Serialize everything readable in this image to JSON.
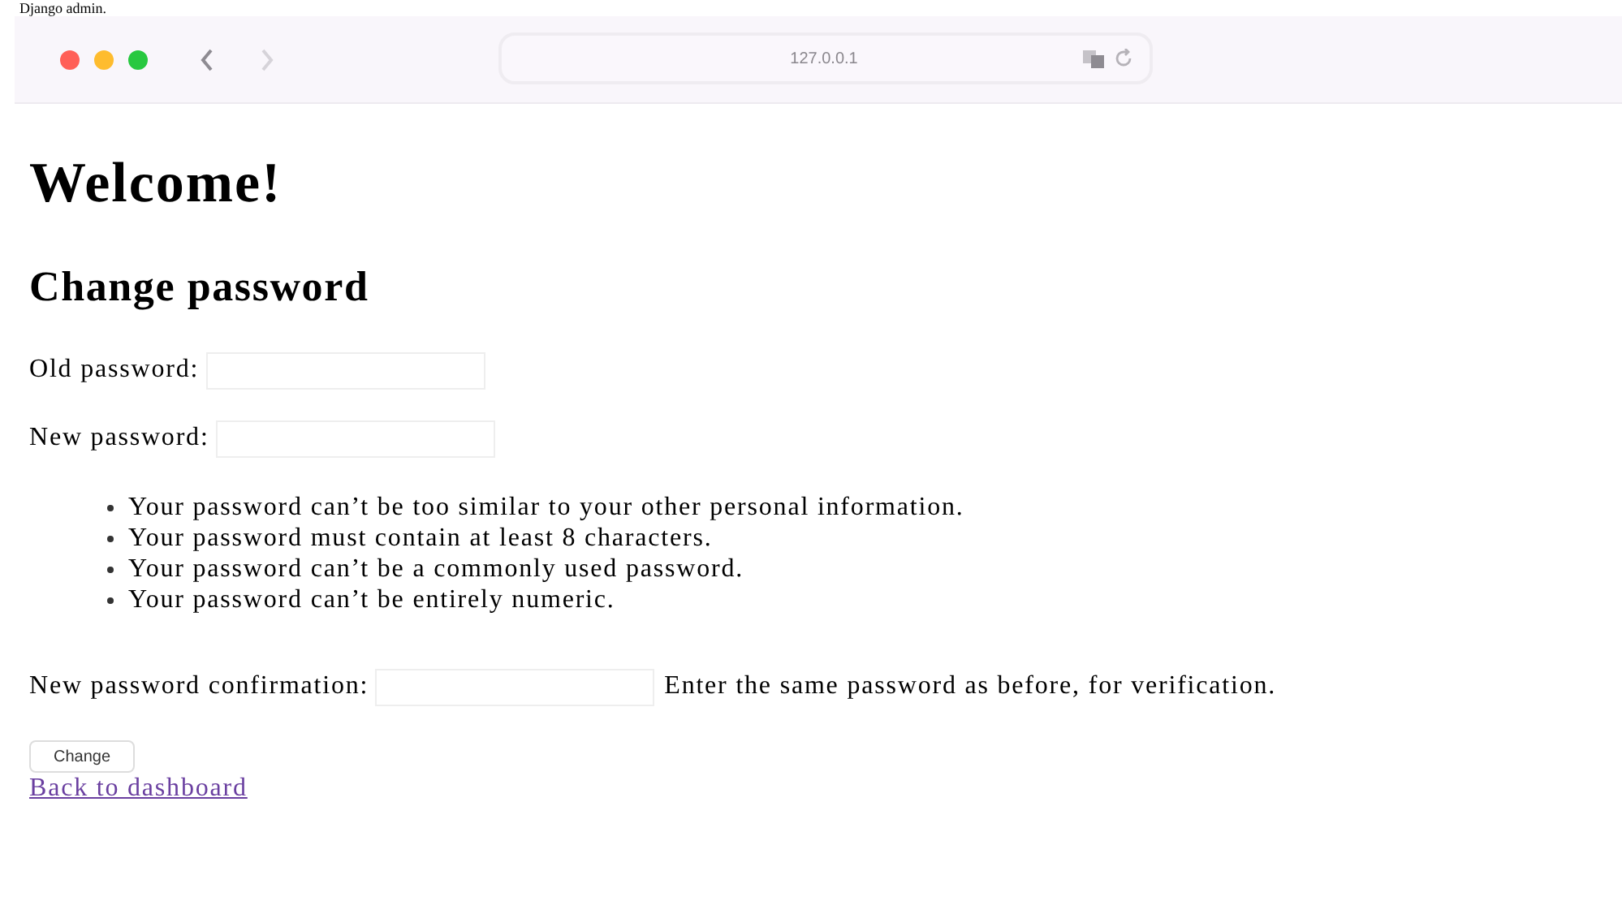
{
  "site_title": "Django admin.",
  "browser": {
    "url": "127.0.0.1",
    "nav": [
      {
        "kind": "back",
        "disabled": false
      },
      {
        "kind": "forward",
        "disabled": true
      }
    ]
  },
  "heading": "Welcome!",
  "form": {
    "title": "Change password",
    "fields": [
      {
        "label": "Old password:"
      },
      {
        "label": "New password:",
        "help": [
          "Your password can’t be too similar to your other personal information.",
          "Your password must contain at least 8 characters.",
          "Your password can’t be a commonly used password.",
          "Your password can’t be entirely numeric."
        ]
      },
      {
        "label": "New password confirmation:",
        "hint": "Enter the same password as before, for verification."
      }
    ],
    "submit": "Change"
  },
  "back_link": "Back to dashboard"
}
